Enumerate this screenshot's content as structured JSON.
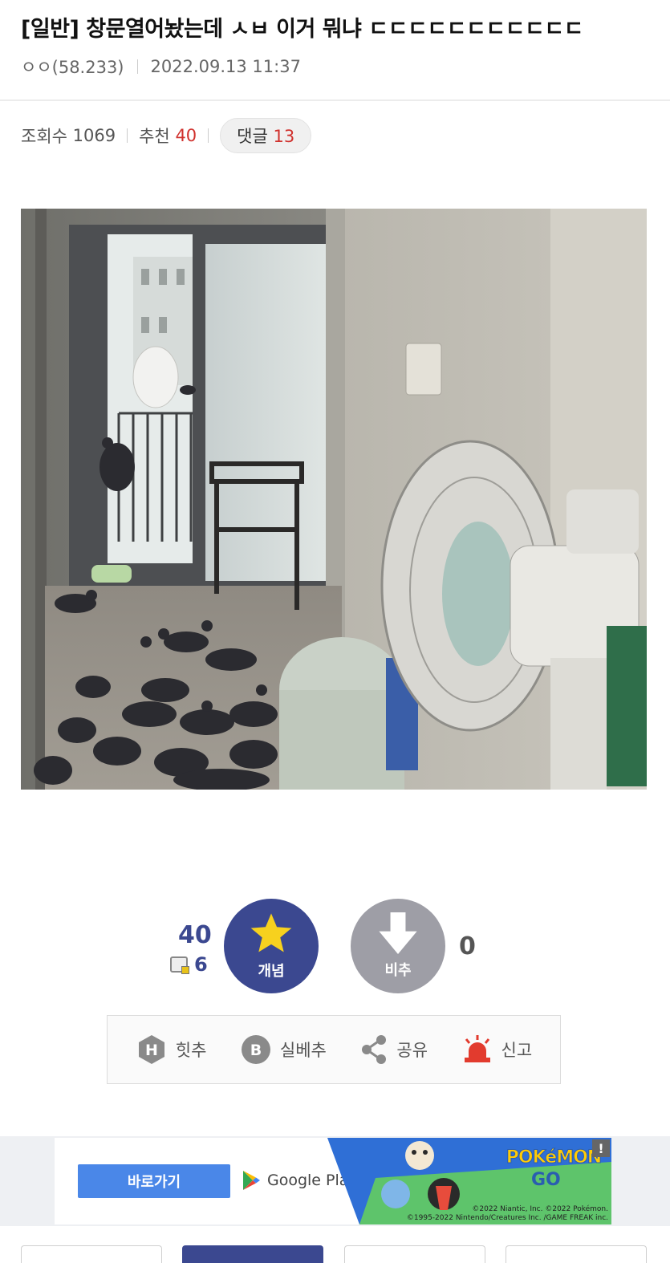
{
  "post": {
    "title": "[일반] 창문열어놨는데 ㅅㅂ 이거 뭐냐 ㄷㄷㄷㄷㄷㄷㄷㄷㄷㄷㄷ",
    "author": "ㅇㅇ(58.233)",
    "datetime": "2022.09.13 11:37"
  },
  "stats": {
    "views_label": "조회수",
    "views": "1069",
    "recommend_label": "추천",
    "recommend": "40",
    "comments_label": "댓글",
    "comments": "13"
  },
  "photo": {
    "subject": "pigeons-in-living-room"
  },
  "vote": {
    "up_count": "40",
    "fixed_count": "6",
    "up_label": "개념",
    "down_label": "비추",
    "down_count": "0"
  },
  "actions": [
    {
      "label": "힛추",
      "icon": "hit-icon"
    },
    {
      "label": "실베추",
      "icon": "best-icon"
    },
    {
      "label": "공유",
      "icon": "share-icon"
    },
    {
      "label": "신고",
      "icon": "siren-icon"
    }
  ],
  "ad": {
    "button_label": "바로가기",
    "store_label": "Google Play",
    "brand_line1": "POKéMON",
    "brand_line2": "GO",
    "copyright_line1": "©2022 Niantic, Inc. ©2022 Pokémon.",
    "copyright_line2": "©1995-2022 Nintendo/Creatures Inc. /GAME FREAK inc.",
    "flag": "!"
  },
  "colors": {
    "accent": "#3b4890",
    "downvote": "#9e9ea6",
    "highlight_red": "#d0312d",
    "star": "#f7d11e",
    "siren": "#e23b2e",
    "ad_button": "#4a87e8"
  }
}
